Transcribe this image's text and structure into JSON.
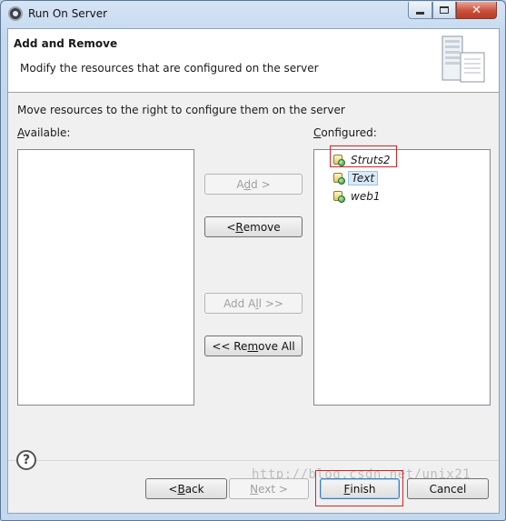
{
  "window": {
    "title": "Run On Server"
  },
  "header": {
    "title": "Add and Remove",
    "description": "Modify the resources that are configured on the server"
  },
  "instructions": "Move resources to the right to configure them on the server",
  "available": {
    "label_pre": "",
    "label_mn": "A",
    "label_post": "vailable:",
    "items": []
  },
  "configured": {
    "label_pre": "",
    "label_mn": "C",
    "label_post": "onfigured:",
    "items": [
      {
        "label": "Struts2",
        "selected": false,
        "icon": "web-project-icon"
      },
      {
        "label": "Text",
        "selected": true,
        "icon": "web-project-icon"
      },
      {
        "label": "web1",
        "selected": false,
        "icon": "web-project-icon"
      }
    ]
  },
  "buttons": {
    "add": {
      "pre": "A",
      "mn": "d",
      "post": "d >",
      "enabled": false
    },
    "remove": {
      "pre": "< ",
      "mn": "R",
      "post": "emove",
      "enabled": true
    },
    "add_all": {
      "pre": "Add A",
      "mn": "l",
      "post": "l >>",
      "enabled": false
    },
    "remove_all": {
      "pre": "<< Re",
      "mn": "m",
      "post": "ove All",
      "enabled": true
    }
  },
  "footer": {
    "back": {
      "pre": "< ",
      "mn": "B",
      "post": "ack",
      "enabled": true
    },
    "next": {
      "pre": "",
      "mn": "N",
      "post": "ext >",
      "enabled": false
    },
    "finish": {
      "pre": "",
      "mn": "F",
      "post": "inish",
      "enabled": true
    },
    "cancel": {
      "label": "Cancel",
      "enabled": true
    }
  },
  "watermark": "http://blog.csdn.net/unix21",
  "colors": {
    "highlight_box": "#e02020",
    "selection": "#dbeaf9"
  }
}
